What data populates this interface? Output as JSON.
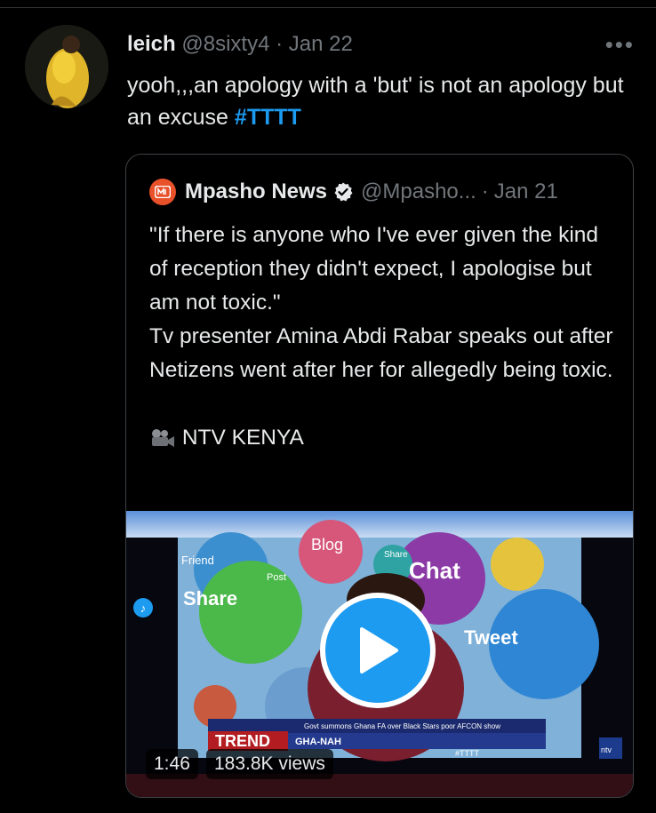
{
  "tweet": {
    "display_name": "leich",
    "handle": "@8sixty4",
    "separator": "·",
    "date": "Jan 22",
    "more_label": "•••",
    "text_main": "yooh,,,an apology with a 'but' is not an apology but an excuse",
    "hashtag": "#TTTT"
  },
  "quoted": {
    "display_name": "Mpasho News",
    "handle": "@Mpasho...",
    "separator": "·",
    "date": "Jan 21",
    "text_lines": [
      "\"If there is anyone who I've ever given the kind of reception they didn't expect, I apologise but am not toxic.\"",
      "Tv presenter Amina Abdi Rabar speaks out after Netizens went after her for allegedly being toxic."
    ],
    "credit": "NTV KENYA",
    "video": {
      "duration": "1:46",
      "views": "183.8K views",
      "bubble_words": [
        "Blog",
        "Friend",
        "Chat",
        "Share",
        "Tweet",
        "Post",
        "Share"
      ],
      "ticker_brand": "TREND",
      "ticker_headline": "Govt summons Ghana FA over Black Stars poor AFCON show",
      "ticker_sub": "GHA-NAH",
      "ticker_hashtag": "#TTTT",
      "channel_logo": "ntv"
    }
  },
  "colors": {
    "background": "#000000",
    "accent": "#1d9bf0",
    "muted": "#71767b",
    "border": "#3d4145",
    "brand_logo": "#e8512a"
  },
  "icons": {
    "verified": "verified-badge-icon",
    "camera": "movie-camera-icon",
    "play": "play-icon",
    "music": "music-note-icon",
    "more": "more-dots-icon"
  }
}
